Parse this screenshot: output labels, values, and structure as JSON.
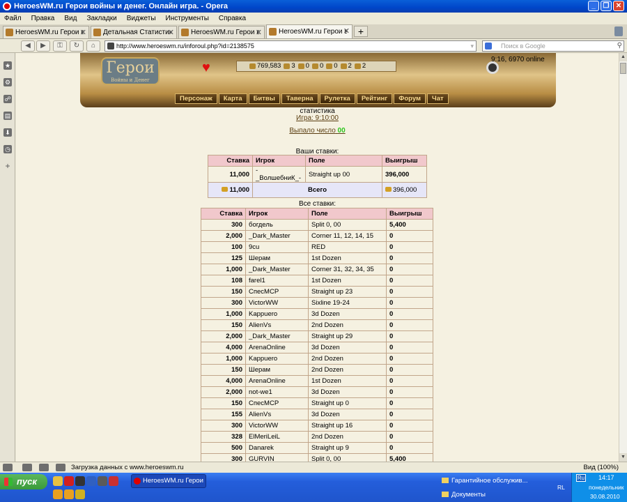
{
  "window": {
    "title": "HeroesWM.ru Герои войны и денег. Онлайн игра. - Opera",
    "minimize": "_",
    "maximize": "❐",
    "close": "✕"
  },
  "menu": [
    "Файл",
    "Правка",
    "Вид",
    "Закладки",
    "Виджеты",
    "Инструменты",
    "Справка"
  ],
  "tabs": [
    {
      "label": "HeroesWM.ru Герои во...",
      "active": false
    },
    {
      "label": "Детальная Статистика...",
      "active": false
    },
    {
      "label": "HeroesWM.ru Герои во...",
      "active": false
    },
    {
      "label": "HeroesWM.ru Герои во...",
      "active": true
    }
  ],
  "address": {
    "url": "http://www.heroeswm.ru/inforoul.php?id=2138575"
  },
  "search": {
    "placeholder": "Поиск в Google"
  },
  "game_header": {
    "logo_title": "Герои",
    "logo_sub": "Войны и Денег",
    "resources": [
      "769,583",
      "3",
      "0",
      "0",
      "0",
      "2",
      "2"
    ],
    "clock": "9:16, 6970 online",
    "nav": [
      "Персонаж",
      "Карта",
      "Битвы",
      "Таверна",
      "Рулетка",
      "Рейтинг",
      "Форум",
      "Чат"
    ]
  },
  "page": {
    "stat_label": "статистика",
    "game_link": "Игра: 9:10:00",
    "dropped_label": "Выпало число",
    "dropped_number": "00",
    "your_bets_title": "Ваши ставки:",
    "all_bets_title": "Все ставки:"
  },
  "headers": {
    "bet": "Ставка",
    "player": "Игрок",
    "field": "Поле",
    "win": "Выигрыш"
  },
  "your_bets": {
    "row": {
      "bet": "11,000",
      "player": "-_ВолшебниК_-",
      "field": "Straight up 00",
      "win": "396,000"
    },
    "total": {
      "bet": "11,000",
      "label": "Всего",
      "win": "396,000"
    }
  },
  "all_bets": [
    {
      "bet": "300",
      "player": "богдель",
      "field": "Split 0, 00",
      "win": "5,400"
    },
    {
      "bet": "2,000",
      "player": "_Dark_Master",
      "field": "Corner 11, 12, 14, 15",
      "win": "0"
    },
    {
      "bet": "100",
      "player": "9cu",
      "field": "RED",
      "win": "0"
    },
    {
      "bet": "125",
      "player": "Шерам",
      "field": "1st Dozen",
      "win": "0"
    },
    {
      "bet": "1,000",
      "player": "_Dark_Master",
      "field": "Corner 31, 32, 34, 35",
      "win": "0"
    },
    {
      "bet": "108",
      "player": "farel1",
      "field": "1st Dozen",
      "win": "0"
    },
    {
      "bet": "150",
      "player": "СпесМСР",
      "field": "Straight up 23",
      "win": "0"
    },
    {
      "bet": "300",
      "player": "VictorWW",
      "field": "Sixline 19-24",
      "win": "0"
    },
    {
      "bet": "1,000",
      "player": "Kappuero",
      "field": "3d Dozen",
      "win": "0"
    },
    {
      "bet": "150",
      "player": "AlienVs",
      "field": "2nd Dozen",
      "win": "0"
    },
    {
      "bet": "2,000",
      "player": "_Dark_Master",
      "field": "Straight up 29",
      "win": "0"
    },
    {
      "bet": "4,000",
      "player": "ArenaOnline",
      "field": "3d Dozen",
      "win": "0"
    },
    {
      "bet": "1,000",
      "player": "Kappuero",
      "field": "2nd Dozen",
      "win": "0"
    },
    {
      "bet": "150",
      "player": "Шерам",
      "field": "2nd Dozen",
      "win": "0"
    },
    {
      "bet": "4,000",
      "player": "ArenaOnline",
      "field": "1st Dozen",
      "win": "0"
    },
    {
      "bet": "2,000",
      "player": "not-we1",
      "field": "3d Dozen",
      "win": "0"
    },
    {
      "bet": "150",
      "player": "СпесМСР",
      "field": "Straight up 0",
      "win": "0"
    },
    {
      "bet": "155",
      "player": "AlienVs",
      "field": "3d Dozen",
      "win": "0"
    },
    {
      "bet": "300",
      "player": "VictorWW",
      "field": "Straight up 16",
      "win": "0"
    },
    {
      "bet": "328",
      "player": "ElMeriLeiL",
      "field": "2nd Dozen",
      "win": "0"
    },
    {
      "bet": "500",
      "player": "Danarek",
      "field": "Straight up 9",
      "win": "0"
    },
    {
      "bet": "300",
      "player": "GURVIN",
      "field": "Split 0, 00",
      "win": "5,400"
    }
  ],
  "status": {
    "message": "Загрузка данных с www.heroeswm.ru",
    "zoom": "Вид (100%)"
  },
  "taskbar": {
    "start": "пуск",
    "task": "HeroesWM.ru Герои ...",
    "folders": [
      "Гарантийное обслужив...",
      "Документы"
    ],
    "lang": "Ru",
    "rl": "RL",
    "time": "14:17",
    "day": "понедельник",
    "date": "30.08.2010"
  }
}
